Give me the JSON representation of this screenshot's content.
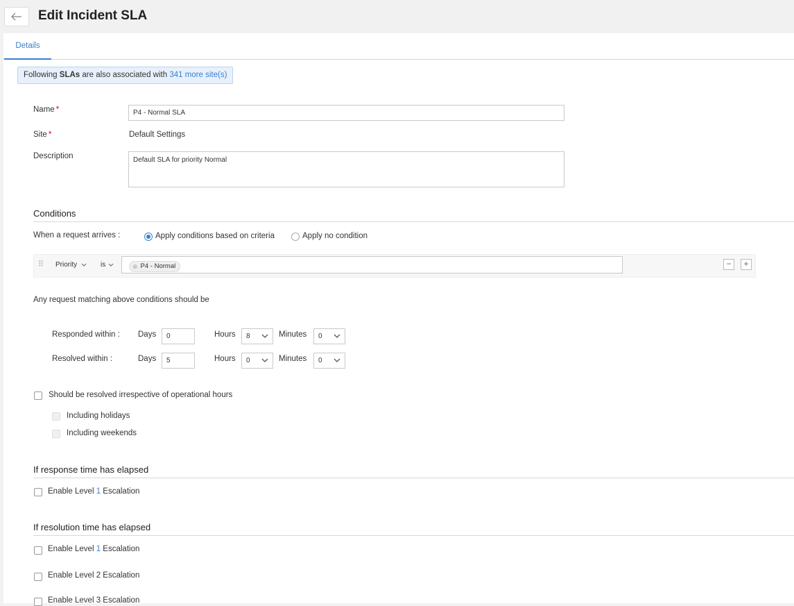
{
  "header": {
    "title": "Edit Incident SLA"
  },
  "tabs": [
    {
      "label": "Details"
    }
  ],
  "banner": {
    "prefix": "Following ",
    "bold": "SLAs",
    "middle": " are also associated with ",
    "link": "341 more site(s)"
  },
  "form": {
    "name_label": "Name",
    "name_value": "P4 - Normal SLA",
    "site_label": "Site",
    "site_value": "Default Settings",
    "description_label": "Description",
    "description_value": "Default SLA for priority Normal"
  },
  "conditions": {
    "title": "Conditions",
    "when_label": "When a request arrives :",
    "option_criteria": "Apply conditions based on criteria",
    "option_none": "Apply no condition",
    "criteria_field": "Priority",
    "criteria_operator": "is",
    "criteria_value": "P4 - Normal",
    "minus": "−",
    "plus": "+"
  },
  "matching": {
    "text": "Any request matching above conditions should be"
  },
  "times": {
    "responded_label": "Responded within :",
    "resolved_label": "Resolved within :",
    "days_label": "Days",
    "hours_label": "Hours",
    "minutes_label": "Minutes",
    "responded": {
      "days": "0",
      "hours": "8",
      "minutes": "0"
    },
    "resolved": {
      "days": "5",
      "hours": "0",
      "minutes": "0"
    }
  },
  "operational": {
    "irrespective_label": "Should be resolved irrespective of operational hours",
    "holidays_label": "Including holidays",
    "weekends_label": "Including weekends"
  },
  "response_elapsed": {
    "title": "If response time has elapsed",
    "level1_pre": "Enable Level ",
    "level1_num": "1",
    "level1_post": " Escalation"
  },
  "resolution_elapsed": {
    "title": "If resolution time has elapsed",
    "level1_pre": "Enable Level ",
    "level1_num": "1",
    "level1_post": " Escalation",
    "level2": "Enable Level 2 Escalation",
    "level3": "Enable Level 3 Escalation"
  },
  "colors": {
    "accent": "#3a7fcf",
    "required": "#d0021b",
    "banner_bg": "#e8f1fb"
  }
}
